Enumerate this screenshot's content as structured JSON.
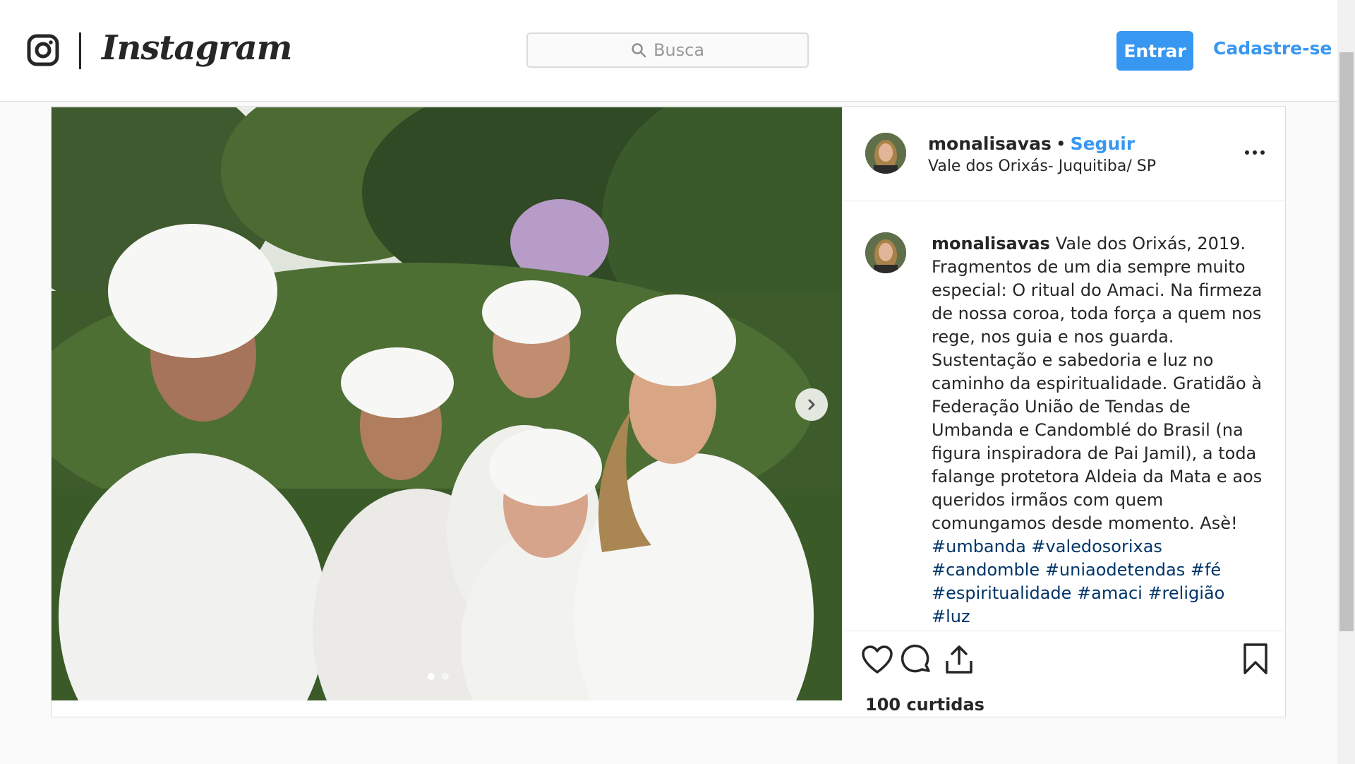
{
  "header": {
    "logo_glyph": "instagram-camera-icon",
    "wordmark": "Instagram",
    "search_placeholder": "Busca",
    "login_label": "Entrar",
    "signup_label": "Cadastre-se"
  },
  "post": {
    "username": "monalisavas",
    "separator": "•",
    "follow_label": "Seguir",
    "location": "Vale dos Orixás- Juquitiba/ SP",
    "more_icon": "more-options-icon",
    "caption_text": "Vale dos Orixás, 2019. Fragmentos de um dia sempre muito especial: O ritual do Amaci. Na firmeza de nossa coroa, toda força a quem nos rege, nos guia e nos guarda. Sustentação e sabedoria e luz no caminho da espiritualidade. Gratidão à Federação União de Tendas de Umbanda e Candomblé do Brasil (na figura inspiradora de Pai Jamil), a toda falange protetora Aldeia da Mata e aos queridos irmãos com quem comungamos desde momento. Asè!",
    "hashtags": "#umbanda #valedosorixas #candomble #uniaodetendas #fé #espiritualidade #amaci #religião #luz",
    "likes": "100 curtidas",
    "carousel_dot_count": 2,
    "carousel_active_index": 0
  },
  "colors": {
    "accent": "#3897f0",
    "hashtag": "#003569",
    "text": "#262626",
    "border": "#dbdbdb"
  }
}
